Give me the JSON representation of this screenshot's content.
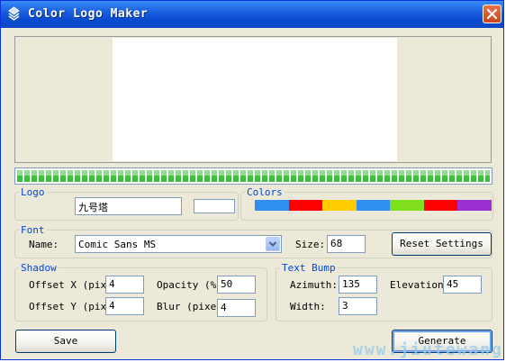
{
  "window": {
    "title": "Color Logo Maker",
    "title_bar_color": "#0a4bd0",
    "close_icon": "close-icon",
    "app_icon": "app-logo-icon"
  },
  "preview": {
    "canvas_color": "#ffffff"
  },
  "progress": {
    "value_percent": 100,
    "color": "#37c43b"
  },
  "logo": {
    "legend": "Logo",
    "text_value": "九号塔",
    "color_value": ""
  },
  "colors": {
    "legend": "Colors",
    "swatches": [
      "#2f8ff0",
      "#ff0000",
      "#ffcc00",
      "#2f8ff0",
      "#80e020",
      "#ff0000",
      "#9a30d0"
    ]
  },
  "font": {
    "legend": "Font",
    "name_label": "Name:",
    "name_value": "Comic Sans MS",
    "size_label": "Size:",
    "size_value": "68",
    "reset_button": "Reset Settings"
  },
  "shadow": {
    "legend": "Shadow",
    "offset_x_label": "Offset X (pixe",
    "offset_x_value": "4",
    "offset_y_label": "Offset Y (pixe",
    "offset_y_value": "4",
    "opacity_label": "Opacity (%)",
    "opacity_value": "50",
    "blur_label": "Blur (pixel",
    "blur_value": "4"
  },
  "text_bump": {
    "legend": "Text Bump",
    "azimuth_label": "Azimuth:",
    "azimuth_value": "135",
    "elevation_label": "Elevation:",
    "elevation_value": "45",
    "width_label": "Width:",
    "width_value": "3"
  },
  "actions": {
    "save": "Save",
    "generate": "Generate"
  },
  "watermark": "www.jiutewang.c"
}
